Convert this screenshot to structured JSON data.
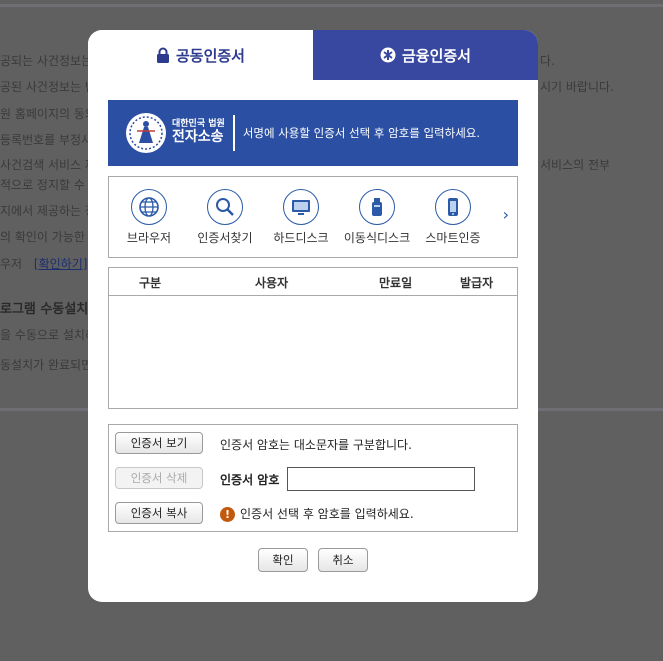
{
  "background": {
    "lines": [
      "공되는 사건정보는",
      "공된 사건정보는 반",
      "원 홈페이지의 동의",
      "등록번호를 부정사",
      "사건검색 서비스 제",
      "적으로 정지할 수",
      "지에서 제공하는 정",
      "의 확인이 가능한 ",
      "우저",
      "로그램 수동설치",
      "을 수동으로 설치하",
      "동설치가 완료되면"
    ],
    "right_lines": [
      "다.",
      "시기 바랍니다.",
      "서비스의 전부"
    ],
    "link": "[확인하기]"
  },
  "tabs": {
    "public_cert": "공동인증서",
    "financial_cert": "금융인증서"
  },
  "banner": {
    "brand_small": "대한민국 법원",
    "brand_big": "전자소송",
    "message": "서명에 사용할 인증서 선택 후 암호를 입력하세요."
  },
  "media": [
    {
      "label": "브라우저",
      "icon": "globe-icon"
    },
    {
      "label": "인증서찾기",
      "icon": "magnifier-icon"
    },
    {
      "label": "하드디스크",
      "icon": "monitor-icon"
    },
    {
      "label": "이동식디스크",
      "icon": "usb-icon"
    },
    {
      "label": "스마트인증",
      "icon": "smartphone-icon"
    }
  ],
  "table": {
    "headers": [
      "구분",
      "사용자",
      "만료일",
      "발급자"
    ]
  },
  "controls": {
    "view_button": "인증서 보기",
    "delete_button": "인증서 삭제",
    "copy_button": "인증서 복사",
    "case_note": "인증서 암호는 대소문자를 구분합니다.",
    "password_label": "인증서 암호",
    "password_value": "",
    "hint": "인증서 선택 후 암호를 입력하세요."
  },
  "footer": {
    "ok": "확인",
    "cancel": "취소"
  },
  "colors": {
    "tab_active_text": "#2d3b8f",
    "tab_inactive_bg": "#3847a0",
    "banner_bg": "#2a4fa3",
    "warning": "#c25a0d"
  }
}
